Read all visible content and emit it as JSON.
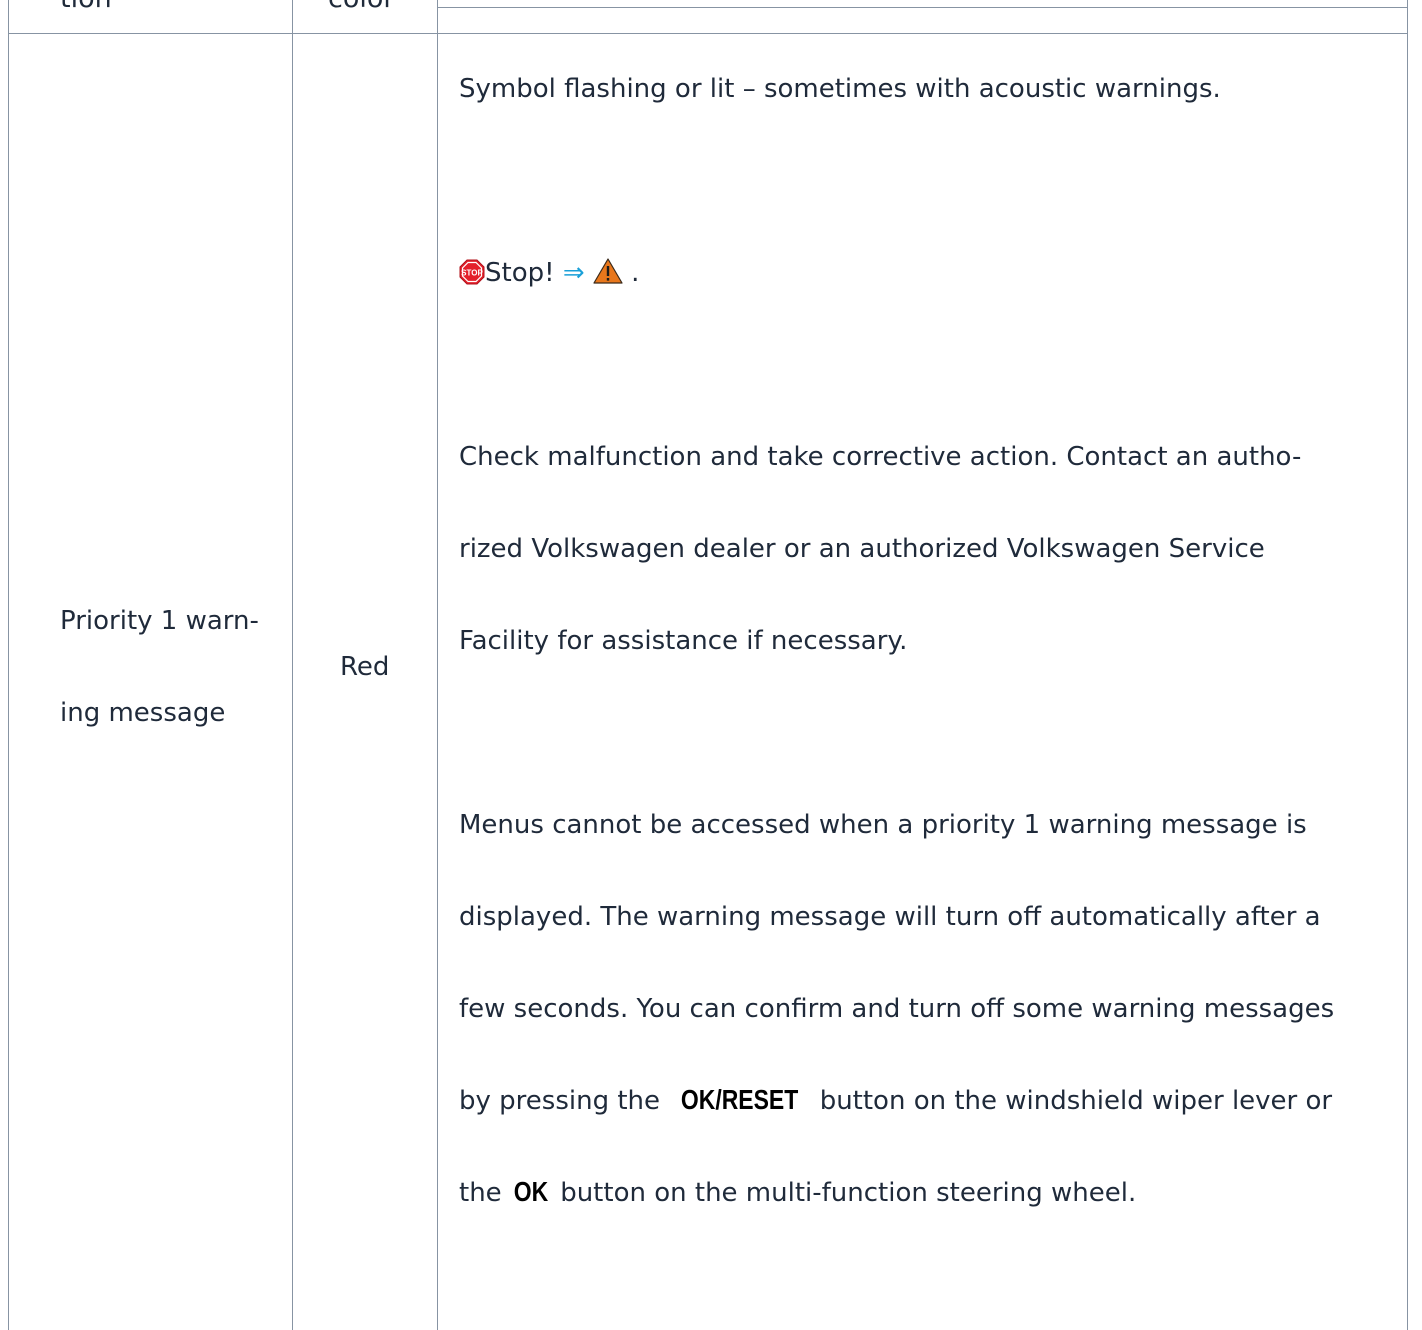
{
  "header": {
    "col1": "tion",
    "col2": "color"
  },
  "row": {
    "type_lines": [
      "Priority 1 warn-",
      "ing message"
    ],
    "color": "Red",
    "description": {
      "p1": "Symbol flashing or lit – sometimes with acoustic warnings.",
      "stop_text": "Stop!",
      "stop_arrow": "⇒",
      "stop_period": ".",
      "p3_lines": [
        "Check malfunction and take corrective action. Contact an autho-",
        "rized Volkswagen dealer or an authorized Volkswagen Service",
        "Facility for assistance if necessary."
      ],
      "p4_lines": [
        "Menus cannot be accessed when a priority 1 warning message is",
        "displayed. The warning message will turn off automatically after a",
        "few seconds. You can confirm and turn off some warning messages"
      ],
      "p4_line4_before": "by pressing the",
      "ok_reset_label": "OK/RESET",
      "p4_line4_after": "button on the windshield wiper lever or",
      "p4_line5_before": "the",
      "ok_label": "OK",
      "p4_line5_after": "button on the multi-function steering wheel."
    }
  },
  "icons": {
    "stop": "stop-sign-icon",
    "warning": "warning-triangle-icon"
  },
  "colors": {
    "border": "#8794a3",
    "link_arrow": "#1aa0d8",
    "stop_red": "#e4202b",
    "warning_orange": "#e8771c"
  }
}
